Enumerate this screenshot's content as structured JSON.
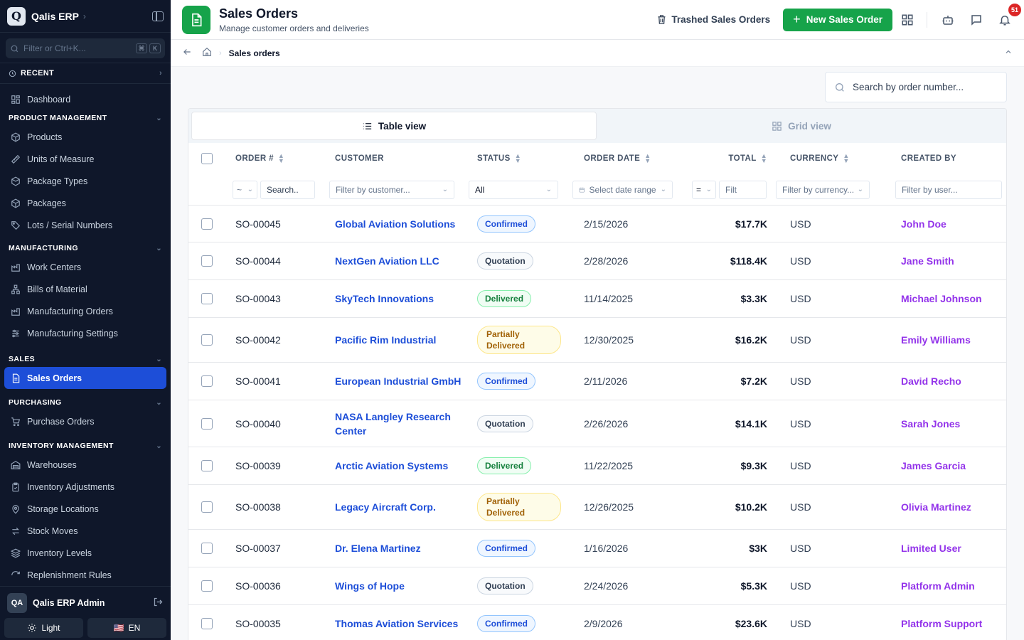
{
  "app": {
    "logo_letter": "Q",
    "name": "Qalis ERP"
  },
  "sidebar": {
    "filter_placeholder": "Filter or Ctrl+K...",
    "kbd": [
      "⌘",
      "K"
    ],
    "recent_label": "RECENT",
    "dashboard": "Dashboard",
    "sections": {
      "product": {
        "title": "PRODUCT MANAGEMENT",
        "items": [
          "Products",
          "Units of Measure",
          "Package Types",
          "Packages",
          "Lots / Serial Numbers"
        ]
      },
      "manufacturing": {
        "title": "MANUFACTURING",
        "items": [
          "Work Centers",
          "Bills of Material",
          "Manufacturing Orders",
          "Manufacturing Settings"
        ]
      },
      "sales": {
        "title": "SALES",
        "items": [
          "Sales Orders"
        ]
      },
      "purchasing": {
        "title": "PURCHASING",
        "items": [
          "Purchase Orders"
        ]
      },
      "inventory": {
        "title": "INVENTORY MANAGEMENT",
        "items": [
          "Warehouses",
          "Inventory Adjustments",
          "Storage Locations",
          "Stock Moves",
          "Inventory Levels",
          "Replenishment Rules"
        ]
      }
    },
    "user": {
      "initials": "QA",
      "name": "Qalis ERP Admin"
    },
    "theme_label": "Light",
    "lang_label": "EN",
    "lang_flag": "🇺🇸"
  },
  "header": {
    "title": "Sales Orders",
    "subtitle": "Manage customer orders and deliveries",
    "trash_label": "Trashed Sales Orders",
    "new_label": "New Sales Order",
    "notif_count": "51"
  },
  "breadcrumb": {
    "current": "Sales orders"
  },
  "search": {
    "placeholder": "Search by order number..."
  },
  "views": {
    "table": "Table view",
    "grid": "Grid view"
  },
  "table": {
    "columns": [
      "ORDER #",
      "CUSTOMER",
      "STATUS",
      "ORDER DATE",
      "TOTAL",
      "CURRENCY",
      "CREATED BY"
    ],
    "filters": {
      "order_op": "~",
      "order_ph": "Search..",
      "customer_ph": "Filter by customer...",
      "status_value": "All",
      "date_ph": "Select date range",
      "total_op": "=",
      "total_ph": "Filt",
      "currency_ph": "Filter by currency...",
      "creator_ph": "Filter by user..."
    },
    "rows": [
      {
        "order": "SO-00045",
        "customer": "Global Aviation Solutions",
        "status": "Confirmed",
        "status_kind": "confirmed",
        "date": "2/15/2026",
        "total": "$17.7K",
        "currency": "USD",
        "created_by": "John Doe"
      },
      {
        "order": "SO-00044",
        "customer": "NextGen Aviation LLC",
        "status": "Quotation",
        "status_kind": "quotation",
        "date": "2/28/2026",
        "total": "$118.4K",
        "currency": "USD",
        "created_by": "Jane Smith"
      },
      {
        "order": "SO-00043",
        "customer": "SkyTech Innovations",
        "status": "Delivered",
        "status_kind": "delivered",
        "date": "11/14/2025",
        "total": "$3.3K",
        "currency": "USD",
        "created_by": "Michael Johnson"
      },
      {
        "order": "SO-00042",
        "customer": "Pacific Rim Industrial",
        "status": "Partially Delivered",
        "status_kind": "partial",
        "date": "12/30/2025",
        "total": "$16.2K",
        "currency": "USD",
        "created_by": "Emily Williams"
      },
      {
        "order": "SO-00041",
        "customer": "European Industrial GmbH",
        "status": "Confirmed",
        "status_kind": "confirmed",
        "date": "2/11/2026",
        "total": "$7.2K",
        "currency": "USD",
        "created_by": "David Recho"
      },
      {
        "order": "SO-00040",
        "customer": "NASA Langley Research Center",
        "status": "Quotation",
        "status_kind": "quotation",
        "date": "2/26/2026",
        "total": "$14.1K",
        "currency": "USD",
        "created_by": "Sarah Jones"
      },
      {
        "order": "SO-00039",
        "customer": "Arctic Aviation Systems",
        "status": "Delivered",
        "status_kind": "delivered",
        "date": "11/22/2025",
        "total": "$9.3K",
        "currency": "USD",
        "created_by": "James Garcia"
      },
      {
        "order": "SO-00038",
        "customer": "Legacy Aircraft Corp.",
        "status": "Partially Delivered",
        "status_kind": "partial",
        "date": "12/26/2025",
        "total": "$10.2K",
        "currency": "USD",
        "created_by": "Olivia Martinez"
      },
      {
        "order": "SO-00037",
        "customer": "Dr. Elena Martinez",
        "status": "Confirmed",
        "status_kind": "confirmed",
        "date": "1/16/2026",
        "total": "$3K",
        "currency": "USD",
        "created_by": "Limited User"
      },
      {
        "order": "SO-00036",
        "customer": "Wings of Hope",
        "status": "Quotation",
        "status_kind": "quotation",
        "date": "2/24/2026",
        "total": "$5.3K",
        "currency": "USD",
        "created_by": "Platform Admin"
      },
      {
        "order": "SO-00035",
        "customer": "Thomas Aviation Services",
        "status": "Confirmed",
        "status_kind": "confirmed",
        "date": "2/9/2026",
        "total": "$23.6K",
        "currency": "USD",
        "created_by": "Platform Support"
      }
    ]
  },
  "colors": {
    "accent": "#16a34a",
    "sidebar_bg": "#0f172a",
    "active_nav": "#1d4ed8",
    "link": "#1d4ed8",
    "creator": "#9333ea"
  }
}
